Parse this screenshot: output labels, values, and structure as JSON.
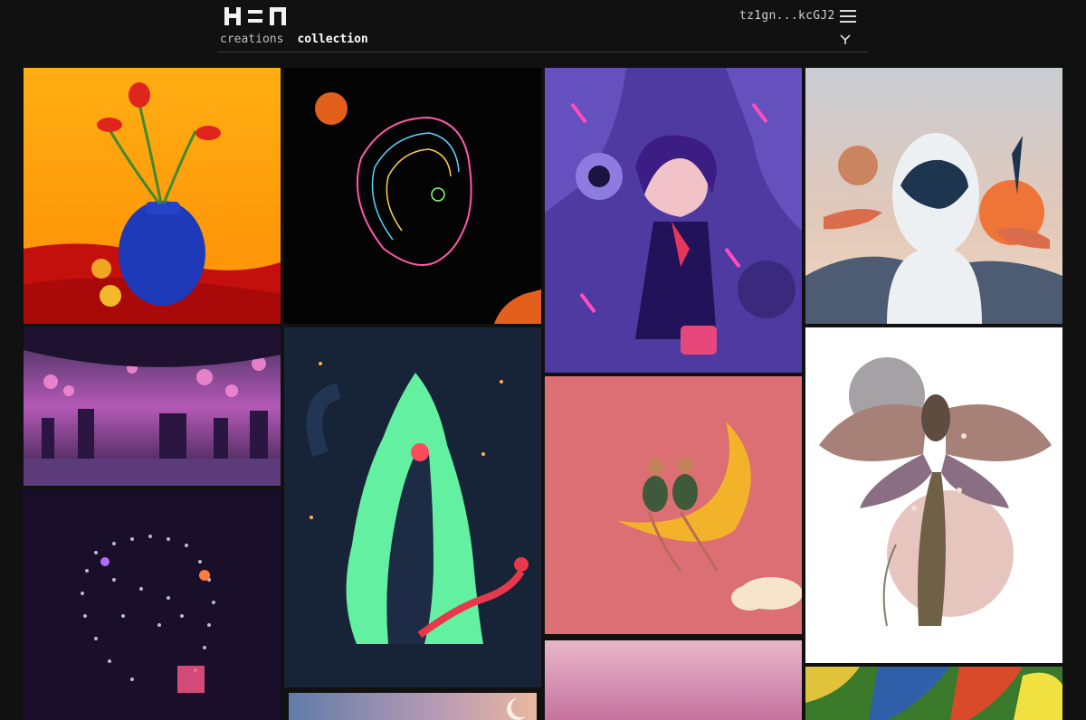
{
  "header": {
    "wallet": "tz1gn...kcGJ2"
  },
  "tabs": [
    {
      "label": "creations",
      "active": false
    },
    {
      "label": "collection",
      "active": true
    }
  ],
  "icons": {
    "logo": "hen-logo",
    "menu": "hamburger-icon",
    "filter": "filter-icon"
  },
  "colors": {
    "background": "#111111",
    "divider": "#3a3a3a"
  },
  "grid": {
    "columns": 4,
    "artworks": [
      {
        "subject": "red tulips in blue vase on orange background"
      },
      {
        "subject": "neon line-art head profile on black"
      },
      {
        "subject": "purple schoolgirl with ghosts illustration"
      },
      {
        "subject": "pale figure with hands and orange sun"
      },
      {
        "subject": "colorful futuristic cityscape with bubbles"
      },
      {
        "subject": "green glowing figure with peacock"
      },
      {
        "subject": "two women sitting on crescent moon, pink"
      },
      {
        "subject": "moth with moon and flowers, white background"
      },
      {
        "subject": "dotted particle head on dark purple"
      },
      {
        "subject": "sunset sky with crescent moon"
      },
      {
        "subject": "pink gradient"
      },
      {
        "subject": "colorful jungle foliage"
      }
    ]
  }
}
